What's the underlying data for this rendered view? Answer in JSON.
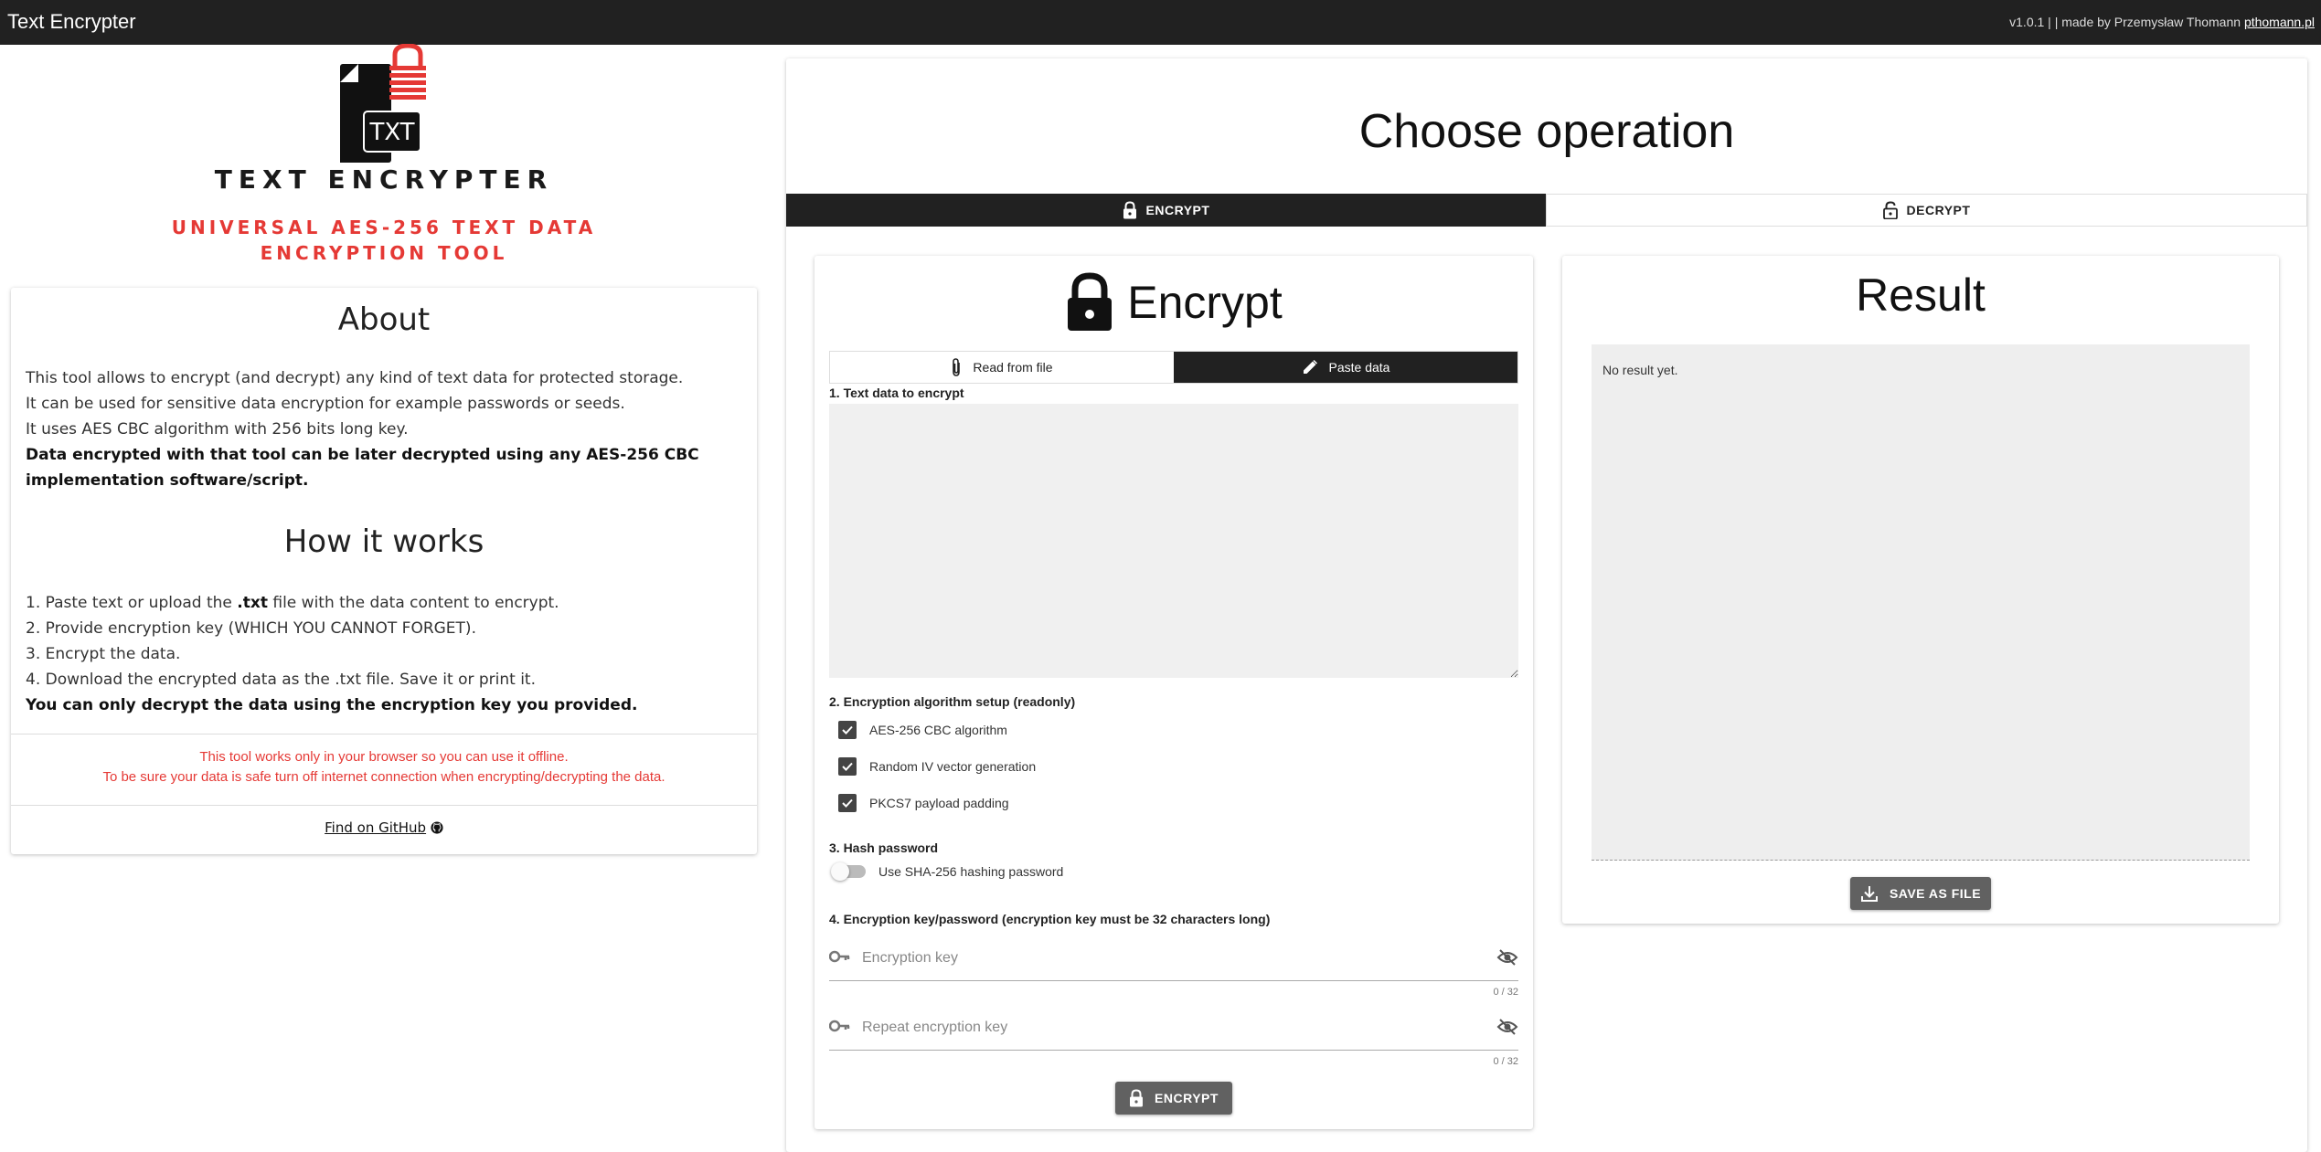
{
  "topbar": {
    "app_title": "Text Encrypter",
    "credits_text": "v1.0.1 | | made by Przemysław Thomann ",
    "credits_link": "pthomann.pl"
  },
  "branding": {
    "logo_text": "TXT",
    "title": "TEXT ENCRYPTER",
    "subtitle_line1": "UNIVERSAL AES-256 TEXT DATA",
    "subtitle_line2": "ENCRYPTION TOOL",
    "accent_color": "#e53935"
  },
  "about": {
    "heading": "About",
    "lines": [
      "This tool allows to encrypt (and decrypt) any kind of text data for protected storage.",
      "It can be used for sensitive data encryption for example passwords or seeds.",
      "It uses AES CBC algorithm with 256 bits long key."
    ],
    "bold_note": "Data encrypted with that tool can be later decrypted using any AES-256 CBC implementation software/script.",
    "how_heading": "How it works",
    "step1_pre": "1. Paste text or upload the ",
    "step1_bold": ".txt",
    "step1_post": " file with the data content to encrypt.",
    "step2": "2. Provide encryption key (WHICH YOU CANNOT FORGET).",
    "step3": "3. Encrypt the data.",
    "step4": "4. Download the encrypted data as the .txt file. Save it or print it.",
    "how_bold": "You can only decrypt the data using the encryption key you provided.",
    "offline_line1": "This tool works only in your browser so you can use it offline.",
    "offline_line2": "To be sure your data is safe turn off internet connection when encrypting/decrypting the data.",
    "github_link": "Find on GitHub"
  },
  "main": {
    "title": "Choose operation",
    "tab_encrypt": "ENCRYPT",
    "tab_decrypt": "DECRYPT",
    "active_tab": "ENCRYPT"
  },
  "encrypt": {
    "heading": "Encrypt",
    "src_file": "Read from file",
    "src_paste": "Paste data",
    "active_source": "Paste data",
    "label_text": "1. Text data to encrypt",
    "text_value": "",
    "label_algo": "2. Encryption algorithm setup (readonly)",
    "checks": [
      {
        "label": "AES-256 CBC algorithm",
        "checked": true
      },
      {
        "label": "Random IV vector generation",
        "checked": true
      },
      {
        "label": "PKCS7 payload padding",
        "checked": true
      }
    ],
    "label_hash": "3. Hash password",
    "hash_toggle_label": "Use SHA-256 hashing password",
    "hash_toggle_on": false,
    "label_key": "4. Encryption key/password (encryption key must be 32 characters long)",
    "key_placeholder": "Encryption key",
    "key_counter": "0 / 32",
    "repeat_placeholder": "Repeat encryption key",
    "repeat_counter": "0 / 32",
    "button": "ENCRYPT"
  },
  "result": {
    "heading": "Result",
    "text": "No result yet.",
    "save_button": "SAVE AS FILE"
  }
}
